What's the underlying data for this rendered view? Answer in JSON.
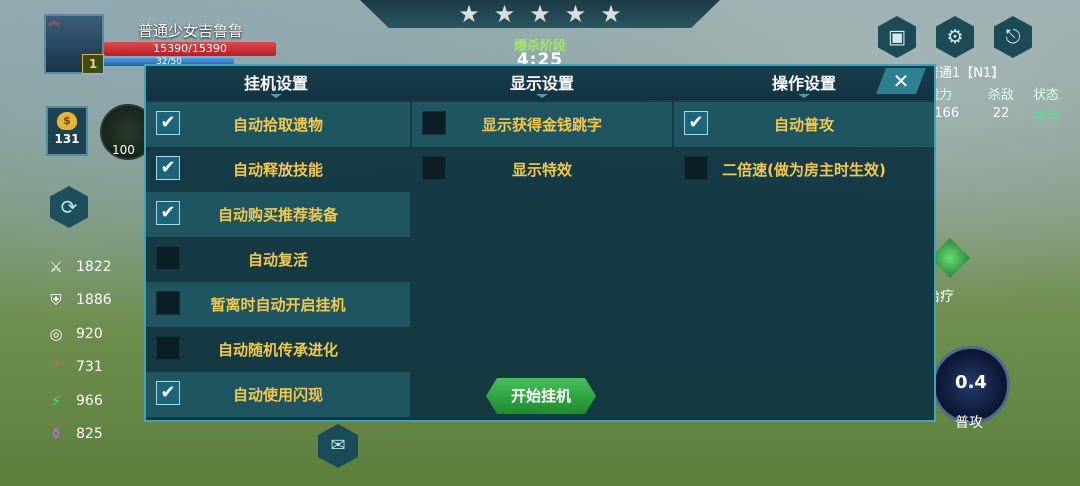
{
  "stars": [
    "★",
    "★",
    "★",
    "★",
    "★"
  ],
  "phase_label": "爆杀阶段",
  "timer": "4:25",
  "player": {
    "name": "普通少女吉鲁鲁",
    "level": "1",
    "hp": "15390/15390",
    "mp": "32/50"
  },
  "gold": "131",
  "skill_cooldown": "100",
  "stats": [
    {
      "icon": "sword-icon",
      "glyph": "⚔",
      "value": "1822",
      "color": "#e6e6e6"
    },
    {
      "icon": "shield-icon",
      "glyph": "⛨",
      "value": "1886",
      "color": "#e6e6e6"
    },
    {
      "icon": "target-icon",
      "glyph": "◎",
      "value": "920",
      "color": "#e6e6e6"
    },
    {
      "icon": "rank-up-icon",
      "glyph": "⌃",
      "value": "731",
      "color": "#e8605a"
    },
    {
      "icon": "lightning-icon",
      "glyph": "⚡",
      "value": "966",
      "color": "#4ee35a"
    },
    {
      "icon": "potion-icon",
      "glyph": "⚱",
      "value": "825",
      "color": "#c067f0"
    }
  ],
  "room": "普通1【N1】",
  "scoreboard": {
    "headers": [
      "战力",
      "杀敌",
      "状态"
    ],
    "row": [
      "5166",
      "22",
      "存活"
    ]
  },
  "heal_label": "治疗",
  "attack": {
    "value": "0.4",
    "label": "普攻"
  },
  "panel": {
    "tabs": [
      "挂机设置",
      "显示设置",
      "操作设置"
    ],
    "close": "✕",
    "idle_settings": [
      {
        "label": "自动拾取遗物",
        "checked": true
      },
      {
        "label": "自动释放技能",
        "checked": true
      },
      {
        "label": "自动购买推荐装备",
        "checked": true
      },
      {
        "label": "自动复活",
        "checked": false
      },
      {
        "label": "暂离时自动开启挂机",
        "checked": false
      },
      {
        "label": "自动随机传承进化",
        "checked": false
      },
      {
        "label": "自动使用闪现",
        "checked": true
      }
    ],
    "display_settings": [
      {
        "label": "显示获得金钱跳字",
        "checked": false
      },
      {
        "label": "显示特效",
        "checked": false
      }
    ],
    "operation_settings": [
      {
        "label": "自动普攻",
        "checked": true
      },
      {
        "label": "二倍速(做为房主时生效)",
        "checked": false
      }
    ],
    "start_button": "开始挂机"
  },
  "colors": {
    "panel_border": "#3ea5b7",
    "label_gold": "#f2c84e",
    "start_green": "#1f8a31",
    "alive_green": "#4ee38a"
  }
}
